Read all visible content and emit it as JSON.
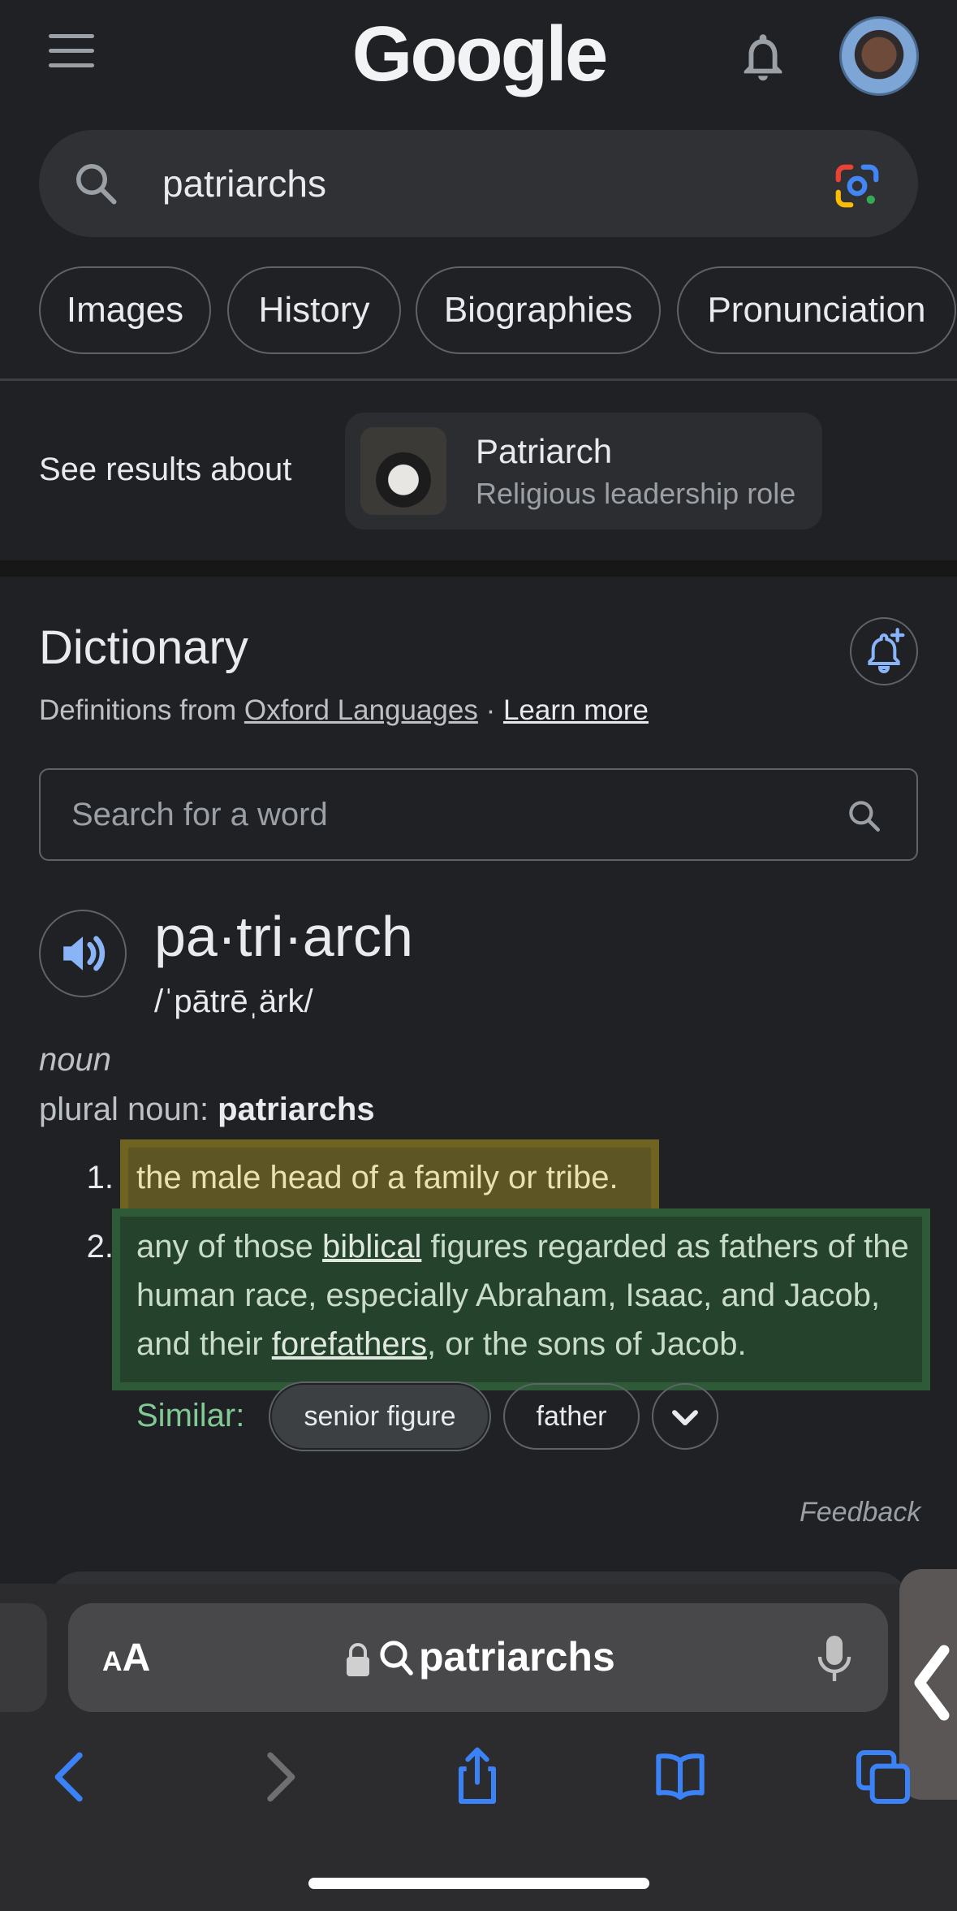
{
  "header": {
    "logo": "Google",
    "menu_icon": "hamburger-menu-icon",
    "bell_icon": "bell-icon"
  },
  "search": {
    "query": "patriarchs",
    "lens_icon": "google-lens-icon"
  },
  "chips": [
    "Images",
    "History",
    "Biographies",
    "Pronunciation"
  ],
  "see_results": {
    "label": "See results about",
    "entity_title": "Patriarch",
    "entity_subtitle": "Religious leadership role"
  },
  "dictionary": {
    "title": "Dictionary",
    "source_prefix": "Definitions from ",
    "source_link": "Oxford Languages",
    "separator": " · ",
    "learn_more": "Learn more",
    "search_placeholder": "Search for a word",
    "headword": "pa·tri·arch",
    "pronunciation": "/ˈpātrēˌärk/",
    "part_of_speech": "noun",
    "plural_label": "plural noun",
    "plural_sep": ": ",
    "plural_value": "patriarchs",
    "definitions": [
      {
        "num": "1.",
        "text": "the male head of a family or tribe."
      },
      {
        "num": "2.",
        "pre": "any of those ",
        "link1": "biblical",
        "mid": " figures regarded as fathers of the human race, especially Abraham, Isaac, and Jacob, and their ",
        "link2": "forefathers",
        "post": ", or the sons of Jacob."
      }
    ],
    "similar_label": "Similar:",
    "similar": [
      "senior figure",
      "father"
    ],
    "feedback": "Feedback"
  },
  "browser": {
    "text_size_label_small": "A",
    "text_size_label_big": "A",
    "url_text": "patriarchs",
    "toolbar_icons": [
      "back-icon",
      "forward-icon",
      "share-icon",
      "bookmarks-icon",
      "tabs-icon"
    ]
  },
  "colors": {
    "background": "#202124",
    "highlight_yellow": "#5e5524",
    "highlight_green": "#24422c",
    "similar_label": "#81c995",
    "toolbar_icon": "#3b82f6"
  }
}
